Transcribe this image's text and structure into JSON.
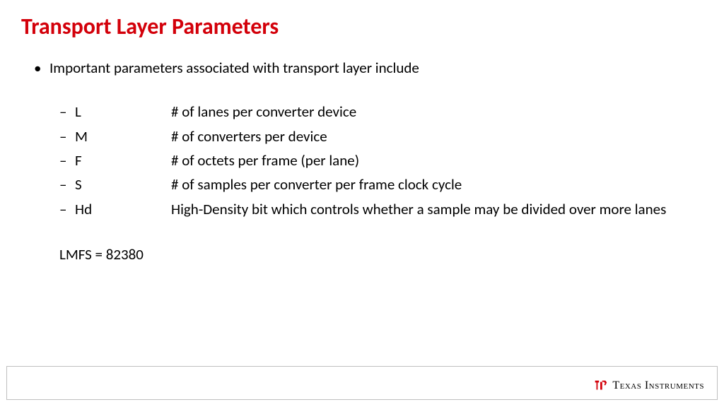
{
  "title": "Transport Layer Parameters",
  "main_bullet": "Important parameters associated with transport layer include",
  "params": [
    {
      "sym": "L",
      "desc": "# of lanes per converter device"
    },
    {
      "sym": "M",
      "desc": "# of converters per device"
    },
    {
      "sym": "F",
      "desc": "# of octets per frame (per lane)"
    },
    {
      "sym": "S",
      "desc": "# of samples per converter per frame clock cycle"
    },
    {
      "sym": "Hd",
      "desc": "High-Density bit which controls whether a sample may be divided over more lanes"
    }
  ],
  "lmfs": "LMFS = 82380",
  "brand": {
    "name": "Texas Instruments"
  }
}
